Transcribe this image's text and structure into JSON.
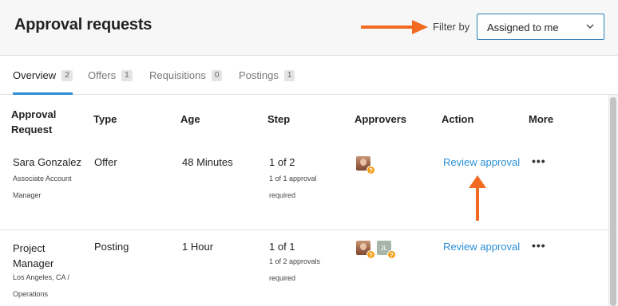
{
  "header": {
    "title": "Approval requests",
    "filter_label": "Filter by",
    "filter_value": "Assigned to me"
  },
  "tabs": [
    {
      "label": "Overview",
      "count": "2",
      "active": true
    },
    {
      "label": "Offers",
      "count": "1",
      "active": false
    },
    {
      "label": "Requisitions",
      "count": "0",
      "active": false
    },
    {
      "label": "Postings",
      "count": "1",
      "active": false
    }
  ],
  "columns": {
    "approval_request": "Approval Request",
    "type": "Type",
    "age": "Age",
    "step": "Step",
    "approvers": "Approvers",
    "action": "Action",
    "more": "More"
  },
  "rows": [
    {
      "name": "Sara Gonzalez",
      "subtitle": "Associate Account Manager",
      "type": "Offer",
      "age": "48 Minutes",
      "step": "1 of 2",
      "step_detail": "1 of 1 approval required",
      "approvers": [
        {
          "kind": "photo",
          "status": "?"
        }
      ],
      "action": "Review approval",
      "more": "•••"
    },
    {
      "name": "Project Manager",
      "subtitle": "Los Angeles, CA / Operations",
      "type": "Posting",
      "age": "1 Hour",
      "step": "1 of 1",
      "step_detail": "1 of 2 approvals required",
      "approvers": [
        {
          "kind": "photo",
          "status": "?"
        },
        {
          "kind": "initials",
          "initials": "JL",
          "status": "?"
        }
      ],
      "action": "Review approval",
      "more": "•••"
    }
  ],
  "icons": {
    "filter_chevron": "chevron-down-icon",
    "pending_badge": "question-icon",
    "more_menu": "ellipsis-icon"
  },
  "colors": {
    "accent": "#2a8fd6",
    "annotation_arrow": "#f26a21",
    "pending": "#f39c12"
  }
}
